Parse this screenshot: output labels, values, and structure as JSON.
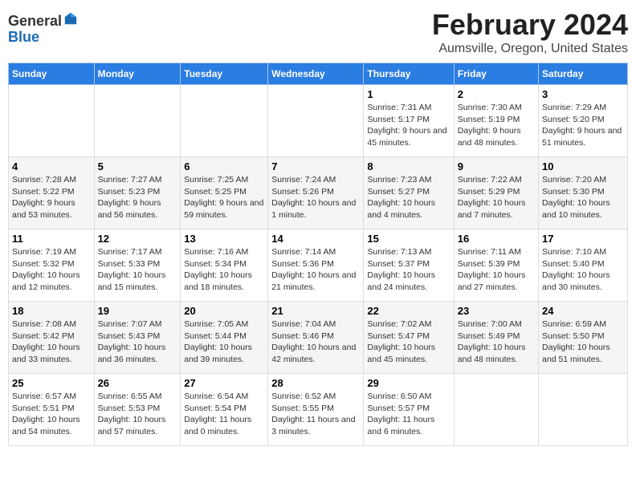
{
  "header": {
    "logo_general": "General",
    "logo_blue": "Blue",
    "main_title": "February 2024",
    "subtitle": "Aumsville, Oregon, United States"
  },
  "weekdays": [
    "Sunday",
    "Monday",
    "Tuesday",
    "Wednesday",
    "Thursday",
    "Friday",
    "Saturday"
  ],
  "weeks": [
    [
      {
        "day": "",
        "sunrise": "",
        "sunset": "",
        "daylight": ""
      },
      {
        "day": "",
        "sunrise": "",
        "sunset": "",
        "daylight": ""
      },
      {
        "day": "",
        "sunrise": "",
        "sunset": "",
        "daylight": ""
      },
      {
        "day": "",
        "sunrise": "",
        "sunset": "",
        "daylight": ""
      },
      {
        "day": "1",
        "sunrise": "Sunrise: 7:31 AM",
        "sunset": "Sunset: 5:17 PM",
        "daylight": "Daylight: 9 hours and 45 minutes."
      },
      {
        "day": "2",
        "sunrise": "Sunrise: 7:30 AM",
        "sunset": "Sunset: 5:19 PM",
        "daylight": "Daylight: 9 hours and 48 minutes."
      },
      {
        "day": "3",
        "sunrise": "Sunrise: 7:29 AM",
        "sunset": "Sunset: 5:20 PM",
        "daylight": "Daylight: 9 hours and 51 minutes."
      }
    ],
    [
      {
        "day": "4",
        "sunrise": "Sunrise: 7:28 AM",
        "sunset": "Sunset: 5:22 PM",
        "daylight": "Daylight: 9 hours and 53 minutes."
      },
      {
        "day": "5",
        "sunrise": "Sunrise: 7:27 AM",
        "sunset": "Sunset: 5:23 PM",
        "daylight": "Daylight: 9 hours and 56 minutes."
      },
      {
        "day": "6",
        "sunrise": "Sunrise: 7:25 AM",
        "sunset": "Sunset: 5:25 PM",
        "daylight": "Daylight: 9 hours and 59 minutes."
      },
      {
        "day": "7",
        "sunrise": "Sunrise: 7:24 AM",
        "sunset": "Sunset: 5:26 PM",
        "daylight": "Daylight: 10 hours and 1 minute."
      },
      {
        "day": "8",
        "sunrise": "Sunrise: 7:23 AM",
        "sunset": "Sunset: 5:27 PM",
        "daylight": "Daylight: 10 hours and 4 minutes."
      },
      {
        "day": "9",
        "sunrise": "Sunrise: 7:22 AM",
        "sunset": "Sunset: 5:29 PM",
        "daylight": "Daylight: 10 hours and 7 minutes."
      },
      {
        "day": "10",
        "sunrise": "Sunrise: 7:20 AM",
        "sunset": "Sunset: 5:30 PM",
        "daylight": "Daylight: 10 hours and 10 minutes."
      }
    ],
    [
      {
        "day": "11",
        "sunrise": "Sunrise: 7:19 AM",
        "sunset": "Sunset: 5:32 PM",
        "daylight": "Daylight: 10 hours and 12 minutes."
      },
      {
        "day": "12",
        "sunrise": "Sunrise: 7:17 AM",
        "sunset": "Sunset: 5:33 PM",
        "daylight": "Daylight: 10 hours and 15 minutes."
      },
      {
        "day": "13",
        "sunrise": "Sunrise: 7:16 AM",
        "sunset": "Sunset: 5:34 PM",
        "daylight": "Daylight: 10 hours and 18 minutes."
      },
      {
        "day": "14",
        "sunrise": "Sunrise: 7:14 AM",
        "sunset": "Sunset: 5:36 PM",
        "daylight": "Daylight: 10 hours and 21 minutes."
      },
      {
        "day": "15",
        "sunrise": "Sunrise: 7:13 AM",
        "sunset": "Sunset: 5:37 PM",
        "daylight": "Daylight: 10 hours and 24 minutes."
      },
      {
        "day": "16",
        "sunrise": "Sunrise: 7:11 AM",
        "sunset": "Sunset: 5:39 PM",
        "daylight": "Daylight: 10 hours and 27 minutes."
      },
      {
        "day": "17",
        "sunrise": "Sunrise: 7:10 AM",
        "sunset": "Sunset: 5:40 PM",
        "daylight": "Daylight: 10 hours and 30 minutes."
      }
    ],
    [
      {
        "day": "18",
        "sunrise": "Sunrise: 7:08 AM",
        "sunset": "Sunset: 5:42 PM",
        "daylight": "Daylight: 10 hours and 33 minutes."
      },
      {
        "day": "19",
        "sunrise": "Sunrise: 7:07 AM",
        "sunset": "Sunset: 5:43 PM",
        "daylight": "Daylight: 10 hours and 36 minutes."
      },
      {
        "day": "20",
        "sunrise": "Sunrise: 7:05 AM",
        "sunset": "Sunset: 5:44 PM",
        "daylight": "Daylight: 10 hours and 39 minutes."
      },
      {
        "day": "21",
        "sunrise": "Sunrise: 7:04 AM",
        "sunset": "Sunset: 5:46 PM",
        "daylight": "Daylight: 10 hours and 42 minutes."
      },
      {
        "day": "22",
        "sunrise": "Sunrise: 7:02 AM",
        "sunset": "Sunset: 5:47 PM",
        "daylight": "Daylight: 10 hours and 45 minutes."
      },
      {
        "day": "23",
        "sunrise": "Sunrise: 7:00 AM",
        "sunset": "Sunset: 5:49 PM",
        "daylight": "Daylight: 10 hours and 48 minutes."
      },
      {
        "day": "24",
        "sunrise": "Sunrise: 6:59 AM",
        "sunset": "Sunset: 5:50 PM",
        "daylight": "Daylight: 10 hours and 51 minutes."
      }
    ],
    [
      {
        "day": "25",
        "sunrise": "Sunrise: 6:57 AM",
        "sunset": "Sunset: 5:51 PM",
        "daylight": "Daylight: 10 hours and 54 minutes."
      },
      {
        "day": "26",
        "sunrise": "Sunrise: 6:55 AM",
        "sunset": "Sunset: 5:53 PM",
        "daylight": "Daylight: 10 hours and 57 minutes."
      },
      {
        "day": "27",
        "sunrise": "Sunrise: 6:54 AM",
        "sunset": "Sunset: 5:54 PM",
        "daylight": "Daylight: 11 hours and 0 minutes."
      },
      {
        "day": "28",
        "sunrise": "Sunrise: 6:52 AM",
        "sunset": "Sunset: 5:55 PM",
        "daylight": "Daylight: 11 hours and 3 minutes."
      },
      {
        "day": "29",
        "sunrise": "Sunrise: 6:50 AM",
        "sunset": "Sunset: 5:57 PM",
        "daylight": "Daylight: 11 hours and 6 minutes."
      },
      {
        "day": "",
        "sunrise": "",
        "sunset": "",
        "daylight": ""
      },
      {
        "day": "",
        "sunrise": "",
        "sunset": "",
        "daylight": ""
      }
    ]
  ]
}
